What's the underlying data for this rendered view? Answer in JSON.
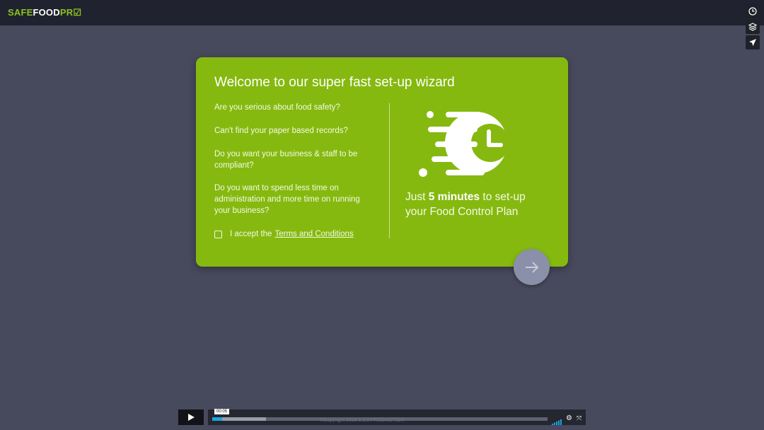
{
  "header": {
    "logo_part1": "SAFE",
    "logo_part2": "FOOD",
    "logo_part3": "PR"
  },
  "side_icons": [
    "clock-icon",
    "layers-icon",
    "send-icon"
  ],
  "wizard": {
    "title": "Welcome to our super fast set-up wizard",
    "questions": [
      "Are you serious about food safety?",
      "Can't find your paper based records?",
      "Do you want your business & staff to be compliant?",
      "Do you want to spend less time on administration and more time on running your business?"
    ],
    "accept_text": "I accept the",
    "terms_link": "Terms and Conditions",
    "tagline_pre": "Just",
    "tagline_bold": "5 minutes",
    "tagline_post": "to set-up",
    "tagline_line2": "your Food Control Plan"
  },
  "player": {
    "timecode": "00:05",
    "copyright": "©Copyright 2018 1.1.5 PRODUCTION",
    "progress_fraction": 0.03,
    "buffered_fraction": 0.16
  },
  "colors": {
    "card": "#85b90f",
    "background": "#474a5c",
    "topbar": "#20232f",
    "accent": "#8dc21f",
    "next_button": "#8a90a9",
    "progress": "#1aa5e0"
  }
}
